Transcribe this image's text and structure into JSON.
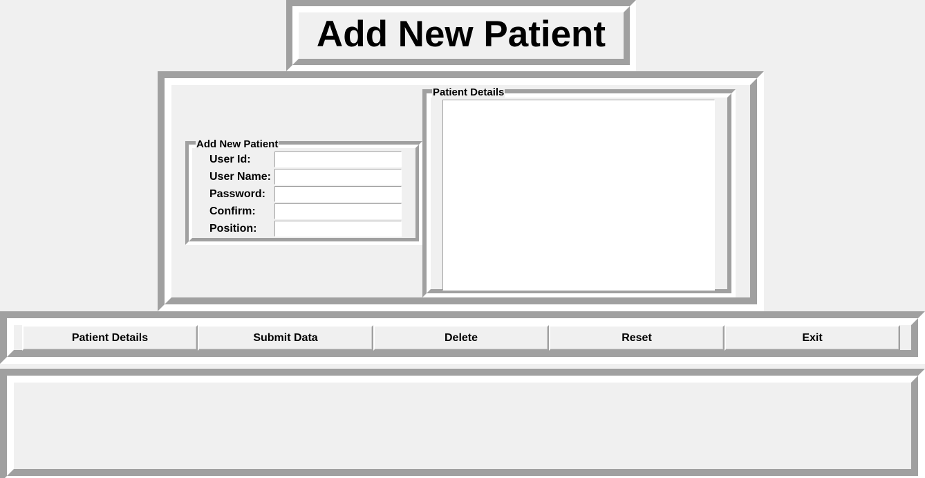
{
  "header": {
    "title": "Add New Patient"
  },
  "add_patient_form": {
    "group_title": "Add New Patient",
    "fields": [
      {
        "label": "User Id:",
        "value": ""
      },
      {
        "label": "User Name:",
        "value": ""
      },
      {
        "label": "Password:",
        "value": ""
      },
      {
        "label": "Confirm:",
        "value": ""
      },
      {
        "label": "Position:",
        "value": ""
      }
    ]
  },
  "patient_details": {
    "group_title": "Patient Details",
    "content": ""
  },
  "buttons": {
    "patient_details": "Patient Details",
    "submit_data": "Submit Data",
    "delete": "Delete",
    "reset": "Reset",
    "exit": "Exit"
  },
  "colors": {
    "background": "#f0f0f0",
    "shadow": "#a0a0a0",
    "highlight": "#ffffff"
  }
}
